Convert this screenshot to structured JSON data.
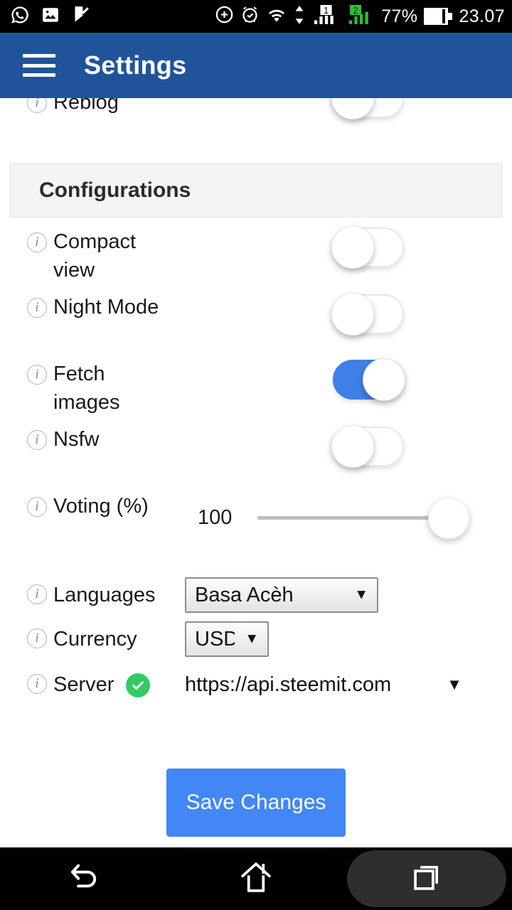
{
  "status_bar": {
    "left_icons": [
      "whatsapp-icon",
      "gallery-icon",
      "checkmark-flag-icon"
    ],
    "right_icons": [
      "plus-circle-icon",
      "alarm-icon",
      "wifi-icon",
      "data-arrows-icon",
      "signal-sim1-icon",
      "signal-sim2-icon"
    ],
    "sim1_label": "1",
    "sim2_label": "2",
    "battery_percent": "77%",
    "time": "23.07"
  },
  "appbar": {
    "menu_icon": "hamburger-menu-icon",
    "title": "Settings",
    "color": "#20549a"
  },
  "partial_row": {
    "label": "Reblog",
    "toggle_on": false
  },
  "section": {
    "title": "Configurations"
  },
  "toggles": [
    {
      "label": "Compact view",
      "on": false
    },
    {
      "label": "Night Mode",
      "on": false
    },
    {
      "label": "Fetch images",
      "on": true
    },
    {
      "label": "Nsfw",
      "on": false
    }
  ],
  "voting": {
    "label": "Voting (%)",
    "value": "100",
    "min": 0,
    "max": 100
  },
  "languages": {
    "label": "Languages",
    "value": "Basa Acèh",
    "arrow": "▼"
  },
  "currency": {
    "label": "Currency",
    "value": "USD",
    "arrow": "▼"
  },
  "server": {
    "label": "Server",
    "status_icon": "green-check-icon",
    "value": "https://api.steemit.com",
    "arrow": "▼"
  },
  "save": {
    "label": "Save Changes",
    "color": "#4287f5"
  },
  "navbar": {
    "back_icon": "back-arrow-icon",
    "home_icon": "home-icon",
    "recent_icon": "recent-apps-icon"
  }
}
